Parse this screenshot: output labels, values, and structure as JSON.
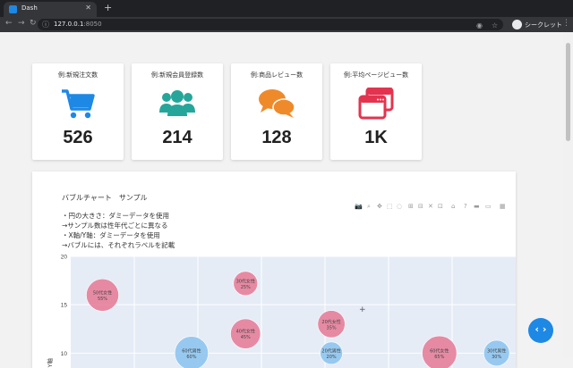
{
  "browser": {
    "tab_title": "Dash",
    "url_host": "127.0.0.1",
    "url_port": ":8050",
    "profile_label": "シークレット"
  },
  "cards": [
    {
      "label": "例:新規注文数",
      "value": "526",
      "icon": "shopping-cart-icon",
      "color": "#1e88e5"
    },
    {
      "label": "例:新規会員登録数",
      "value": "214",
      "icon": "users-icon",
      "color": "#26a69a"
    },
    {
      "label": "例:商品レビュー数",
      "value": "128",
      "icon": "comments-icon",
      "color": "#ef8a2b"
    },
    {
      "label": "例:平均ページビュー数",
      "value": "1K",
      "icon": "browser-windows-icon",
      "color": "#e2344f"
    }
  ],
  "panel": {
    "title": "バブルチャート　サンプル",
    "desc": [
      "・円の大きさ：ダミーデータを使用",
      "→サンプル数は性年代ごとに異なる",
      "・X軸/Y軸：ダミーデータを使用",
      "→バブルには、それぞれラベルを記載"
    ]
  },
  "chart_data": {
    "type": "scatter",
    "ylabel": "Y軸",
    "yticks": [
      10,
      15,
      20
    ],
    "ylim": [
      8,
      20
    ],
    "xlim": [
      0,
      10
    ],
    "grid": true,
    "colors": {
      "female": "#e57f9a",
      "male": "#8ec5f0",
      "plot_bg": "#e5ecf6"
    },
    "points": [
      {
        "label": "50代女性",
        "value": "55%",
        "x": 1.0,
        "y": 16.0,
        "size": 55,
        "group": "female"
      },
      {
        "label": "30代女性",
        "value": "25%",
        "x": 5.5,
        "y": 17.2,
        "size": 25,
        "group": "female"
      },
      {
        "label": "40代女性",
        "value": "45%",
        "x": 5.5,
        "y": 12.0,
        "size": 45,
        "group": "female"
      },
      {
        "label": "60代男性",
        "value": "60%",
        "x": 3.8,
        "y": 10.0,
        "size": 60,
        "group": "male"
      },
      {
        "label": "20代女性",
        "value": "35%",
        "x": 8.2,
        "y": 13.0,
        "size": 35,
        "group": "female"
      },
      {
        "label": "20代男性",
        "value": "20%",
        "x": 8.2,
        "y": 10.0,
        "size": 20,
        "group": "male"
      },
      {
        "label": "60代女性",
        "value": "65%",
        "x": 11.6,
        "y": 10.0,
        "size": 65,
        "group": "female"
      },
      {
        "label": "30代男性",
        "value": "30%",
        "x": 13.4,
        "y": 10.0,
        "size": 30,
        "group": "male"
      }
    ]
  }
}
